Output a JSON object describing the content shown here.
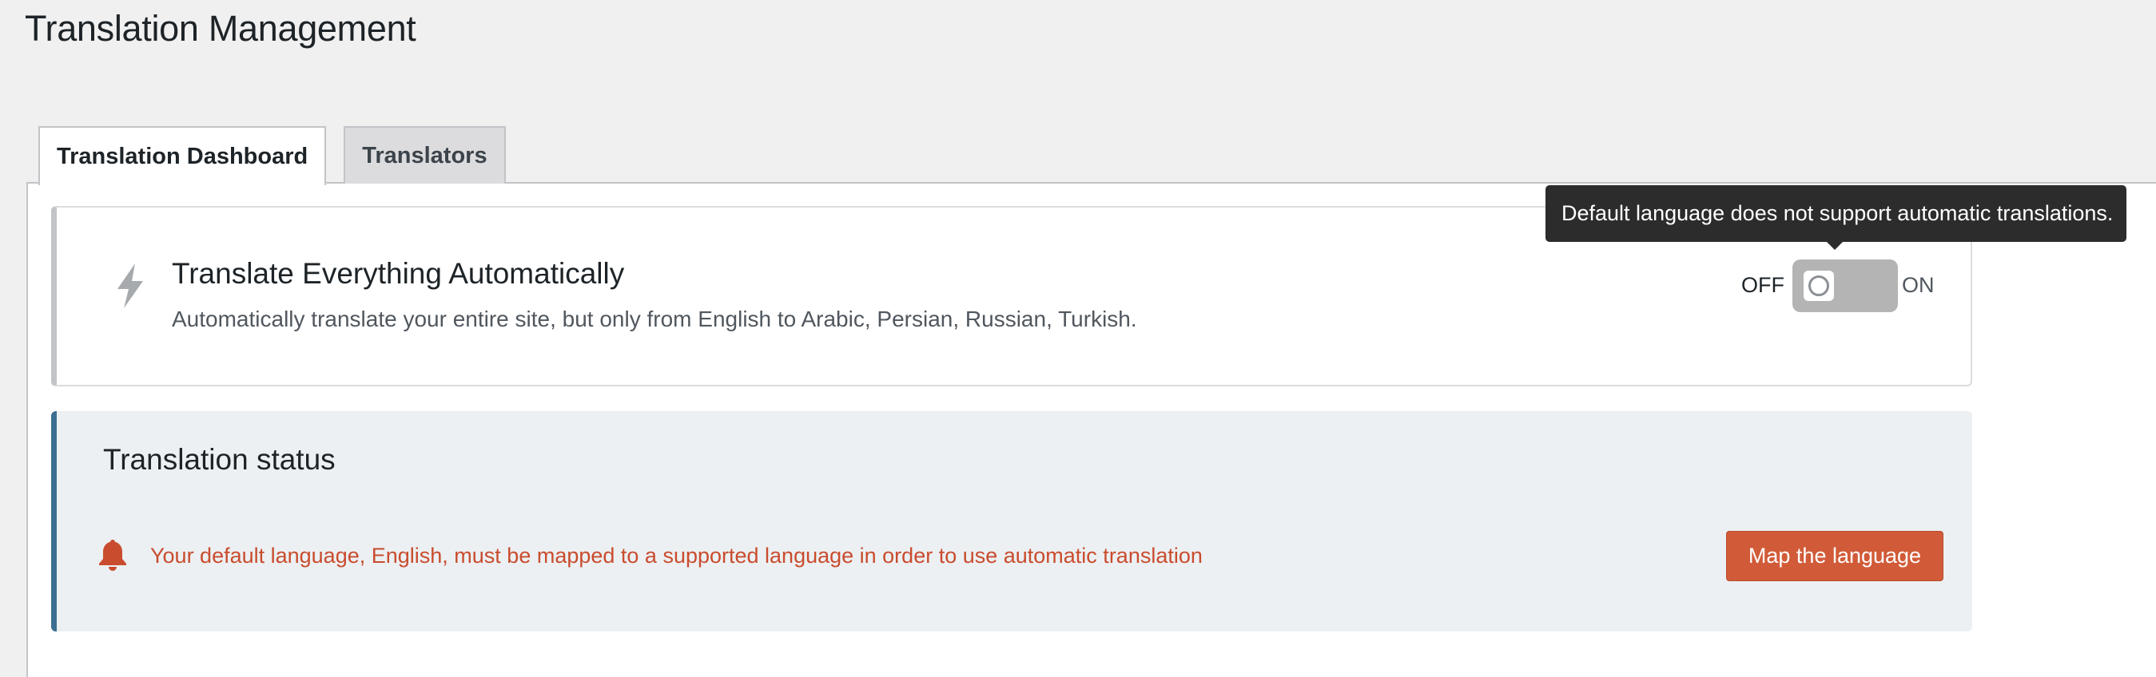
{
  "page": {
    "title": "Translation Management"
  },
  "tabs": [
    {
      "label": "Translation Dashboard",
      "active": true
    },
    {
      "label": "Translators",
      "active": false
    }
  ],
  "auto_translate": {
    "icon": "bolt-icon",
    "title": "Translate Everything Automatically",
    "description": "Automatically translate your entire site, but only from English to Arabic, Persian, Russian, Turkish.",
    "toggle_off_label": "OFF",
    "toggle_on_label": "ON",
    "toggle_state": "off",
    "tooltip": "Default language does not support automatic translations."
  },
  "translation_status": {
    "title": "Translation status",
    "icon": "bell-icon",
    "message": "Your default language, English, must be mapped to a supported language in order to use automatic translation",
    "button_label": "Map the language"
  },
  "colors": {
    "accent_button": "#d15b38",
    "warning_text": "#c94c2e",
    "status_border": "#3c6e8f",
    "status_bg": "#ecf0f2",
    "tooltip_bg": "#2c2c2c"
  }
}
